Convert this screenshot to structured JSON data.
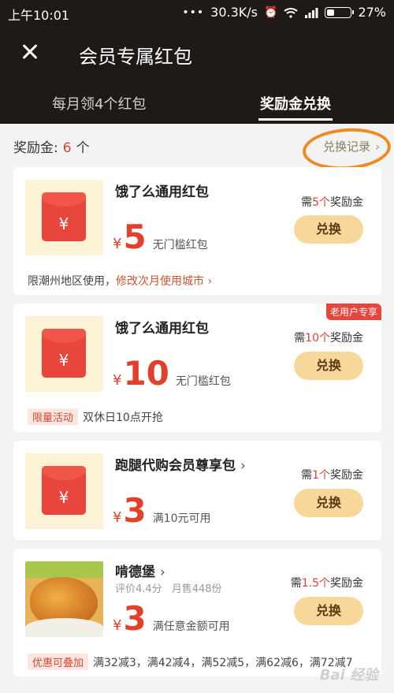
{
  "status_bar": {
    "time": "上午10:01",
    "dots": "•••",
    "speed": "30.3K/s",
    "battery": "27%",
    "battery_level": 0.27
  },
  "header": {
    "title": "会员专属红包",
    "tabs": [
      {
        "label": "每月领4个红包",
        "active": false
      },
      {
        "label": "奖励金兑换",
        "active": true
      }
    ]
  },
  "balance": {
    "label": "奖励金:",
    "count": "6",
    "unit": "个",
    "history_link": "兑换记录"
  },
  "cards": [
    {
      "title": "饿了么通用红包",
      "price_symbol": "¥",
      "price": "5",
      "price_note": "无门槛红包",
      "req_prefix": "需",
      "req_amount": "5个",
      "req_suffix": "奖励金",
      "button": "兑换",
      "footer_text": "限潮州地区使用，",
      "footer_link": "修改次月使用城市 ›",
      "envelope_symbol": "¥"
    },
    {
      "title": "饿了么通用红包",
      "badge": "老用户专享",
      "price_symbol": "¥",
      "price": "10",
      "price_note": "无门槛红包",
      "req_prefix": "需",
      "req_amount": "10个",
      "req_suffix": "奖励金",
      "button": "兑换",
      "footer_tag": "限量活动",
      "footer_text": "双休日10点开抢",
      "envelope_symbol": "¥"
    },
    {
      "title": "跑腿代购会员尊享包",
      "title_chevron": "›",
      "price_symbol": "¥",
      "price": "3",
      "price_note": "满10元可用",
      "req_prefix": "需",
      "req_amount": "1个",
      "req_suffix": "奖励金",
      "button": "兑换",
      "envelope_symbol": "¥"
    },
    {
      "title": "啃德堡",
      "title_chevron": "›",
      "rating": "评价4.4分",
      "monthly_sales": "月售448份",
      "price_symbol": "¥",
      "price": "3",
      "price_note": "满任意金额可用",
      "req_prefix": "需",
      "req_amount": "1.5个",
      "req_suffix": "奖励金",
      "button": "兑换",
      "footer_tag": "优惠可叠加",
      "footer_text": "满32减3，满42减4，满52减5，满62减6，满72减7"
    }
  ],
  "watermark": "Bai 经验"
}
